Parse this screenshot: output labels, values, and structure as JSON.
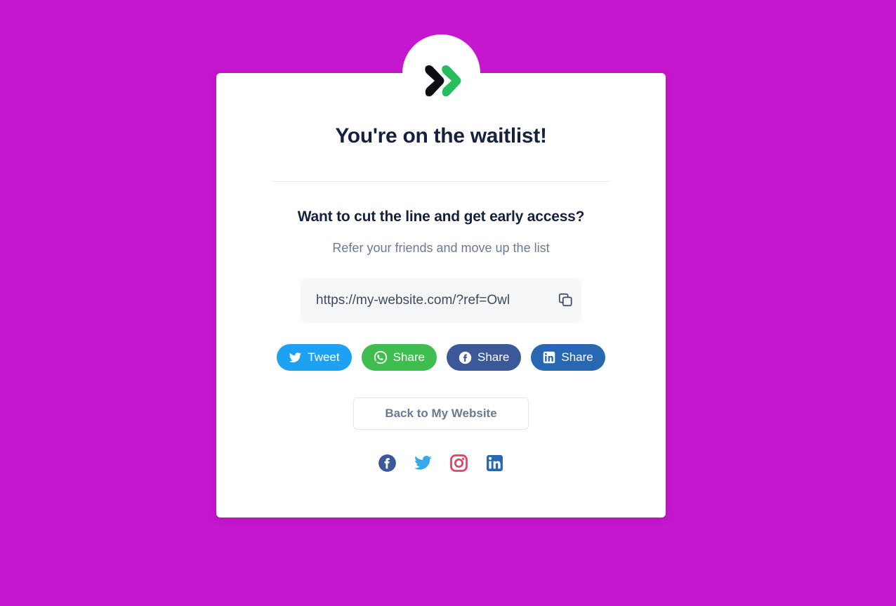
{
  "page": {
    "background_color": "#c517cd",
    "card_background": "#ffffff"
  },
  "logo": {
    "name": "double-chevron-logo",
    "chevron_dark_color": "#0d0d12",
    "chevron_green_color": "#26bd5c"
  },
  "heading": {
    "title": "You're on the waitlist!"
  },
  "referral": {
    "sub_head": "Want to cut the line and get early access?",
    "sub_text": "Refer your friends and move up the list",
    "link_value": "https://my-website.com/?ref=Owl",
    "link_placeholder": "https://my-website.com/?ref=",
    "copy_icon": "copy-icon",
    "copy_icon_color": "#3f4a5f"
  },
  "share_buttons": [
    {
      "label": "Tweet",
      "icon": "twitter-icon",
      "color": "#1da1f2",
      "name": "share-twitter"
    },
    {
      "label": "Share",
      "icon": "whatsapp-icon",
      "color": "#3fbd4e",
      "name": "share-whatsapp"
    },
    {
      "label": "Share",
      "icon": "facebook-icon",
      "color": "#3b5998",
      "name": "share-facebook"
    },
    {
      "label": "Share",
      "icon": "linkedin-icon",
      "color": "#2867b2",
      "name": "share-linkedin"
    }
  ],
  "back_button": {
    "label": "Back to My Website",
    "text_color": "#6b7a90",
    "border_color": "#e4e6ea"
  },
  "footer_socials": [
    {
      "icon": "facebook-icon",
      "color": "#3b5998",
      "name": "footer-facebook"
    },
    {
      "icon": "twitter-icon",
      "color": "#35a9ec",
      "name": "footer-twitter"
    },
    {
      "icon": "instagram-icon",
      "color": "#e4405f",
      "name": "footer-instagram"
    },
    {
      "icon": "linkedin-icon",
      "color": "#2867b2",
      "name": "footer-linkedin"
    }
  ]
}
